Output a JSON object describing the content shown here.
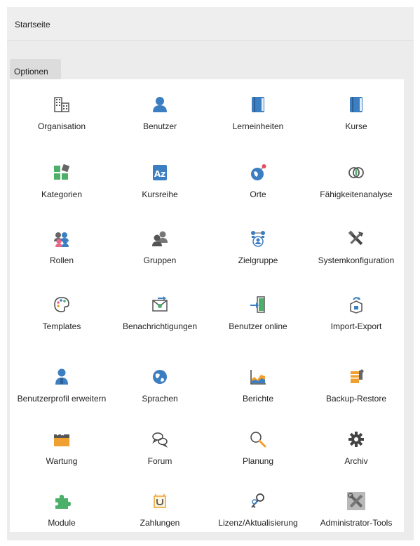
{
  "breadcrumb": {
    "label": "Startseite"
  },
  "options_tab": {
    "label": "Optionen"
  },
  "tiles": [
    {
      "label": "Organisation",
      "icon": "organisation-icon"
    },
    {
      "label": "Benutzer",
      "icon": "user-icon"
    },
    {
      "label": "Lerneinheiten",
      "icon": "book-icon"
    },
    {
      "label": "Kurse",
      "icon": "book-icon"
    },
    {
      "label": "Kategorien",
      "icon": "categories-icon"
    },
    {
      "label": "Kursreihe",
      "icon": "az-sort-icon"
    },
    {
      "label": "Orte",
      "icon": "globe-pin-icon"
    },
    {
      "label": "Fähigkeitenanalyse",
      "icon": "overlap-circles-icon"
    },
    {
      "label": "Rollen",
      "icon": "roles-icon"
    },
    {
      "label": "Gruppen",
      "icon": "group-icon"
    },
    {
      "label": "Zielgruppe",
      "icon": "target-group-icon"
    },
    {
      "label": "Systemkonfiguration",
      "icon": "tools-icon"
    },
    {
      "label": "Templates",
      "icon": "palette-icon"
    },
    {
      "label": "Benachrichtigungen",
      "icon": "mail-icon"
    },
    {
      "label": "Benutzer online",
      "icon": "door-enter-icon"
    },
    {
      "label": "Import-Export",
      "icon": "import-export-icon"
    },
    {
      "label": "Benutzerprofil erweitern",
      "icon": "user-profile-icon"
    },
    {
      "label": "Sprachen",
      "icon": "globe-icon"
    },
    {
      "label": "Berichte",
      "icon": "area-chart-icon"
    },
    {
      "label": "Backup-Restore",
      "icon": "backup-icon"
    },
    {
      "label": "Wartung",
      "icon": "maintenance-box-icon"
    },
    {
      "label": "Forum",
      "icon": "speech-bubbles-icon"
    },
    {
      "label": "Planung",
      "icon": "magnifier-icon"
    },
    {
      "label": "Archiv",
      "icon": "gear-icon"
    },
    {
      "label": "Module",
      "icon": "puzzle-icon"
    },
    {
      "label": "Zahlungen",
      "icon": "payment-icon"
    },
    {
      "label": "Lizenz/Aktualisierung",
      "icon": "key-icon"
    },
    {
      "label": "Administrator-Tools",
      "icon": "admin-tools-icon"
    }
  ],
  "colors": {
    "accent_blue": "#3c7ec2",
    "green": "#4caf6a",
    "orange": "#f0a030",
    "gray": "#666666"
  }
}
